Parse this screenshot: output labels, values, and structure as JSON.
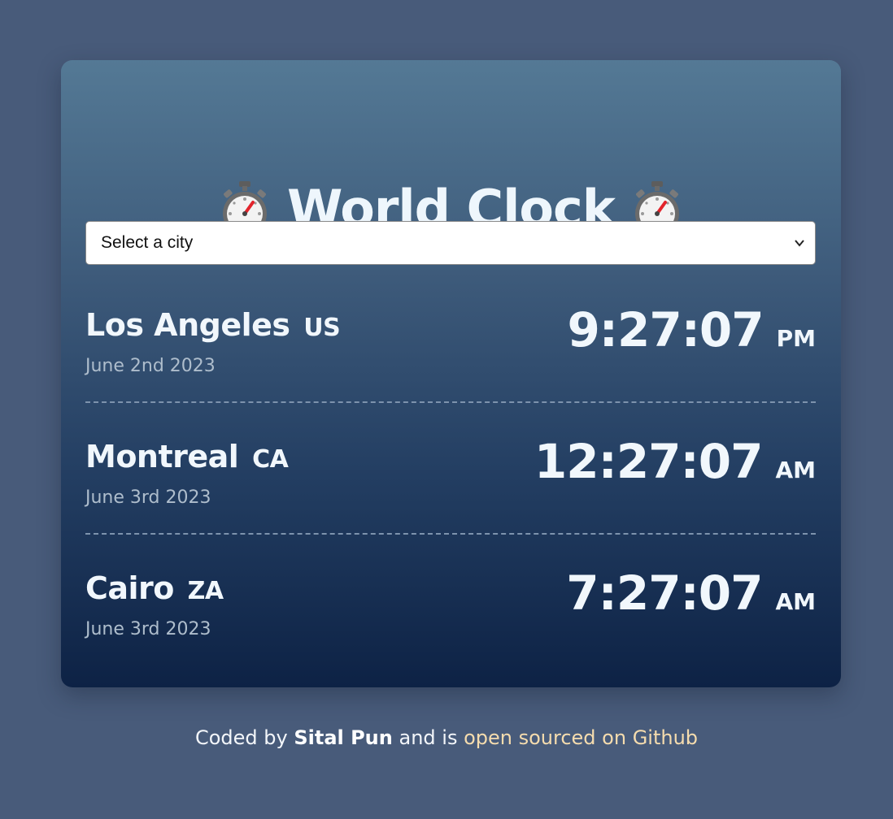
{
  "title": "World Clock",
  "title_icon": "stopwatch-icon",
  "city_select": {
    "value": "Select a city"
  },
  "cities": [
    {
      "name": "Los Angeles",
      "country": "US",
      "date": "June 2nd 2023",
      "time": "9:27:07",
      "ampm": "PM"
    },
    {
      "name": "Montreal",
      "country": "CA",
      "date": "June 3rd 2023",
      "time": "12:27:07",
      "ampm": "AM"
    },
    {
      "name": "Cairo",
      "country": "ZA",
      "date": "June 3rd 2023",
      "time": "7:27:07",
      "ampm": "AM"
    }
  ],
  "footer": {
    "prefix": "Coded by ",
    "author": "Sital Pun",
    "middle": " and is ",
    "link_text": "open sourced on Github"
  },
  "colors": {
    "background": "#485b7a",
    "card_top": "#547995",
    "card_bottom": "#0d2245",
    "link": "#f5dcae"
  }
}
